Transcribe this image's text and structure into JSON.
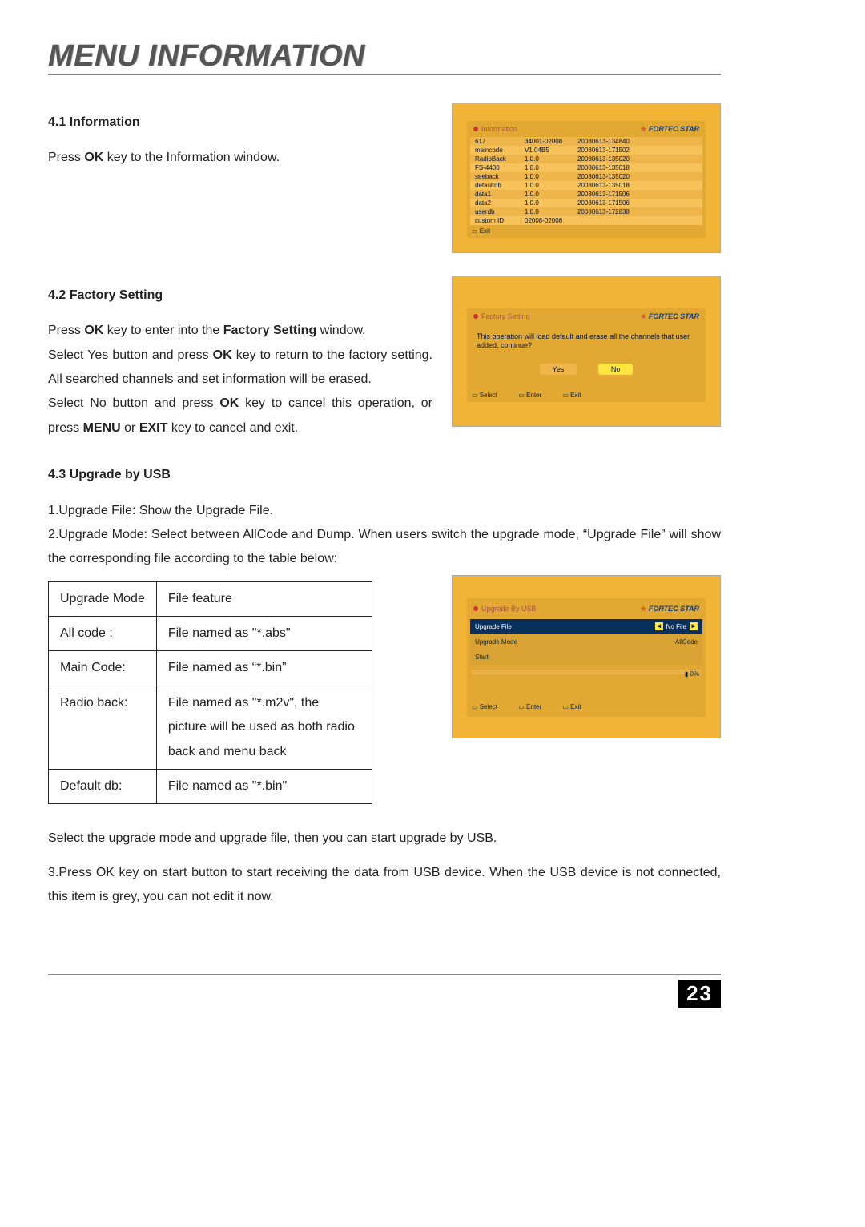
{
  "page_title": "MENU INFORMATION",
  "page_number": "23",
  "s41": {
    "heading": "4.1 Information",
    "body_pre": "Press ",
    "body_ok": "OK",
    "body_post": " key to the Information window.",
    "screen": {
      "title": "Information",
      "brand": "FORTEC STAR",
      "rows": [
        {
          "a": "617",
          "b": "34001-02008",
          "c": "20080613-134840"
        },
        {
          "a": "maincode",
          "b": "V1.04B5",
          "c": "20080613-171502"
        },
        {
          "a": "RadioBack",
          "b": "1.0.0",
          "c": "20080613-135020"
        },
        {
          "a": "FS-4400",
          "b": "1.0.0",
          "c": "20080613-135018"
        },
        {
          "a": "seeback",
          "b": "1.0.0",
          "c": "20080613-135020"
        },
        {
          "a": "defaultdb",
          "b": "1.0.0",
          "c": "20080613-135018"
        },
        {
          "a": "data1",
          "b": "1.0.0",
          "c": "20080613-171506"
        },
        {
          "a": "data2",
          "b": "1.0.0",
          "c": "20080613-171506"
        },
        {
          "a": "userdb",
          "b": "1.0.0",
          "c": "20080613-172838"
        },
        {
          "a": "custom ID",
          "b": "02008-02008",
          "c": ""
        }
      ],
      "foot_exit": "Exit"
    }
  },
  "s42": {
    "heading": "4.2 Factory Setting",
    "p1a": "Press ",
    "p1ok": "OK",
    "p1b": " key to enter into the ",
    "p1fs": "Factory Setting",
    "p1c": " window.",
    "p2a": "Select Yes button and press ",
    "p2ok": "OK",
    "p2b": " key to return to the factory setting. All searched channels and set information will be erased.",
    "p3a": "Select No button and press ",
    "p3ok": "OK",
    "p3b": " key to cancel this operation, or press ",
    "p3menu": "MENU",
    "p3c": " or ",
    "p3exit": "EXIT",
    "p3d": " key to cancel and exit.",
    "screen": {
      "title": "Factory Setting",
      "brand": "FORTEC STAR",
      "msg": "This operation will load default and erase all the channels that user added, continue?",
      "yes": "Yes",
      "no": "No",
      "f_select": "Select",
      "f_enter": "Enter",
      "f_exit": "Exit"
    }
  },
  "s43": {
    "heading": "4.3 Upgrade by USB",
    "l1": "1.Upgrade File: Show the Upgrade File.",
    "l2": "2.Upgrade Mode: Select between AllCode and  Dump. When users switch the upgrade mode, “Upgrade File” will show the corresponding file according to the table below:",
    "table": {
      "h1": "Upgrade Mode",
      "h2": "File feature",
      "rows": [
        {
          "a": "All code :",
          "b": "File named as \"*.abs\""
        },
        {
          "a": "Main Code:",
          "b": "File named as “*.bin”"
        },
        {
          "a": "Radio back:",
          "b": "File named as \"*.m2v\", the picture will be used as both radio back and menu back"
        },
        {
          "a": "Default db:",
          "b": "File named as \"*.bin\""
        }
      ]
    },
    "after_table": "Select the upgrade mode and upgrade file, then you can start upgrade by USB.",
    "l3": "3.Press OK key on start button to start receiving the data from USB device. When the USB device is not connected, this item is grey, you can not edit it now.",
    "screen": {
      "title": "Upgrade By USB",
      "brand": "FORTEC STAR",
      "r1l": "Upgrade File",
      "r1v": "No File",
      "r2l": "Upgrade Mode",
      "r2v": "AllCode",
      "r3l": "Start",
      "pct": "0%",
      "f_select": "Select",
      "f_enter": "Enter",
      "f_exit": "Exit"
    }
  }
}
